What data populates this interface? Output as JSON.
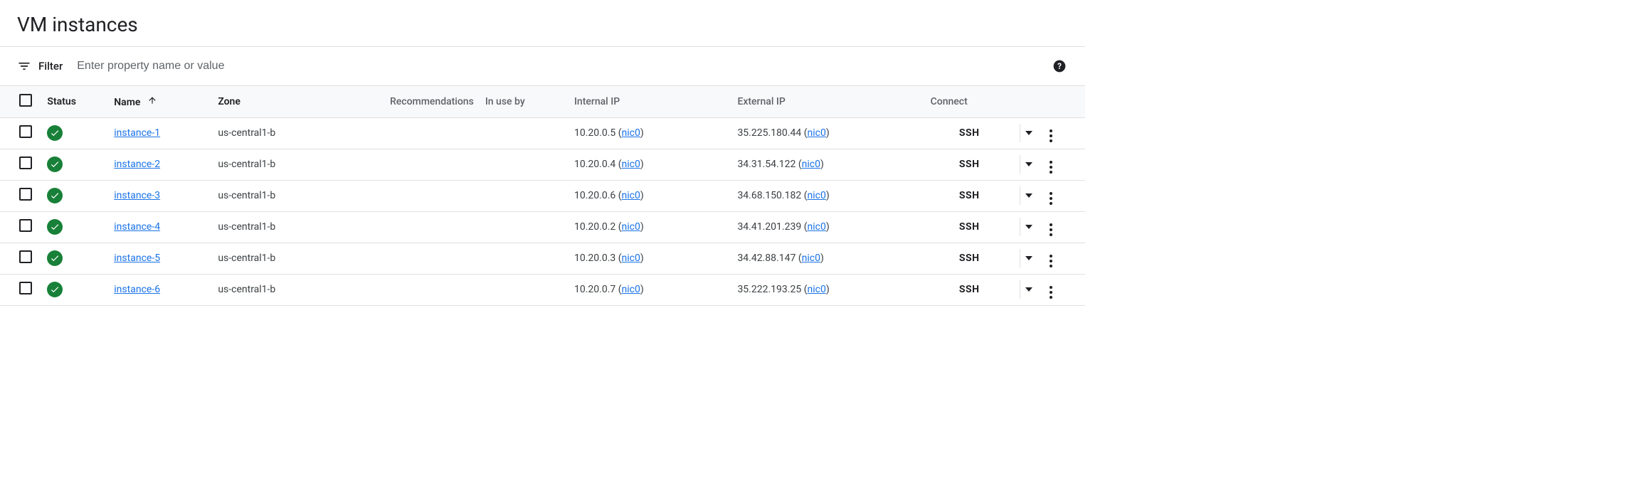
{
  "page_title": "VM instances",
  "filter": {
    "label": "Filter",
    "placeholder": "Enter property name or value"
  },
  "columns": {
    "status": "Status",
    "name": "Name",
    "zone": "Zone",
    "recommendations": "Recommendations",
    "in_use_by": "In use by",
    "internal_ip": "Internal IP",
    "external_ip": "External IP",
    "connect": "Connect"
  },
  "nic_label": "nic0",
  "ssh_label": "SSH",
  "rows": [
    {
      "name": "instance-1",
      "zone": "us-central1-b",
      "internal_ip": "10.20.0.5",
      "external_ip": "35.225.180.44"
    },
    {
      "name": "instance-2",
      "zone": "us-central1-b",
      "internal_ip": "10.20.0.4",
      "external_ip": "34.31.54.122"
    },
    {
      "name": "instance-3",
      "zone": "us-central1-b",
      "internal_ip": "10.20.0.6",
      "external_ip": "34.68.150.182"
    },
    {
      "name": "instance-4",
      "zone": "us-central1-b",
      "internal_ip": "10.20.0.2",
      "external_ip": "34.41.201.239"
    },
    {
      "name": "instance-5",
      "zone": "us-central1-b",
      "internal_ip": "10.20.0.3",
      "external_ip": "34.42.88.147"
    },
    {
      "name": "instance-6",
      "zone": "us-central1-b",
      "internal_ip": "10.20.0.7",
      "external_ip": "35.222.193.25"
    }
  ]
}
